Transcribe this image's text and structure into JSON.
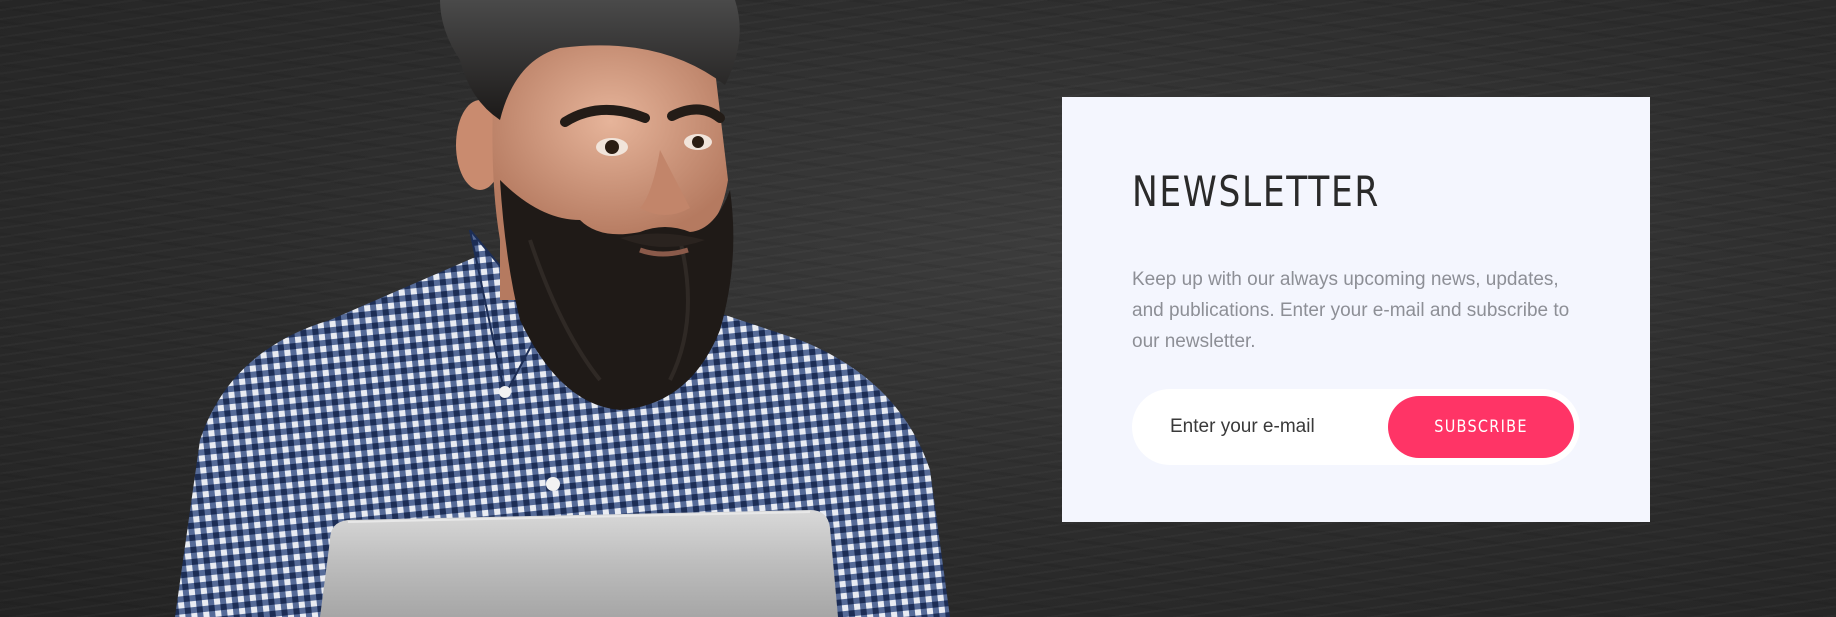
{
  "newsletter": {
    "title": "NEWSLETTER",
    "description": "Keep up with our always upcoming news, updates, and publications. Enter your e-mail and subscribe to our newsletter.",
    "email_placeholder": "Enter your e-mail",
    "email_value": "",
    "subscribe_label": "SUBSCRIBE"
  },
  "colors": {
    "background": "#2c2c2c",
    "card": "#f4f6fe",
    "accent": "#ff3466",
    "title": "#2a2a2a",
    "body_text": "#8d8f96"
  },
  "images": {
    "hero": "bearded-man-with-laptop-photo"
  }
}
